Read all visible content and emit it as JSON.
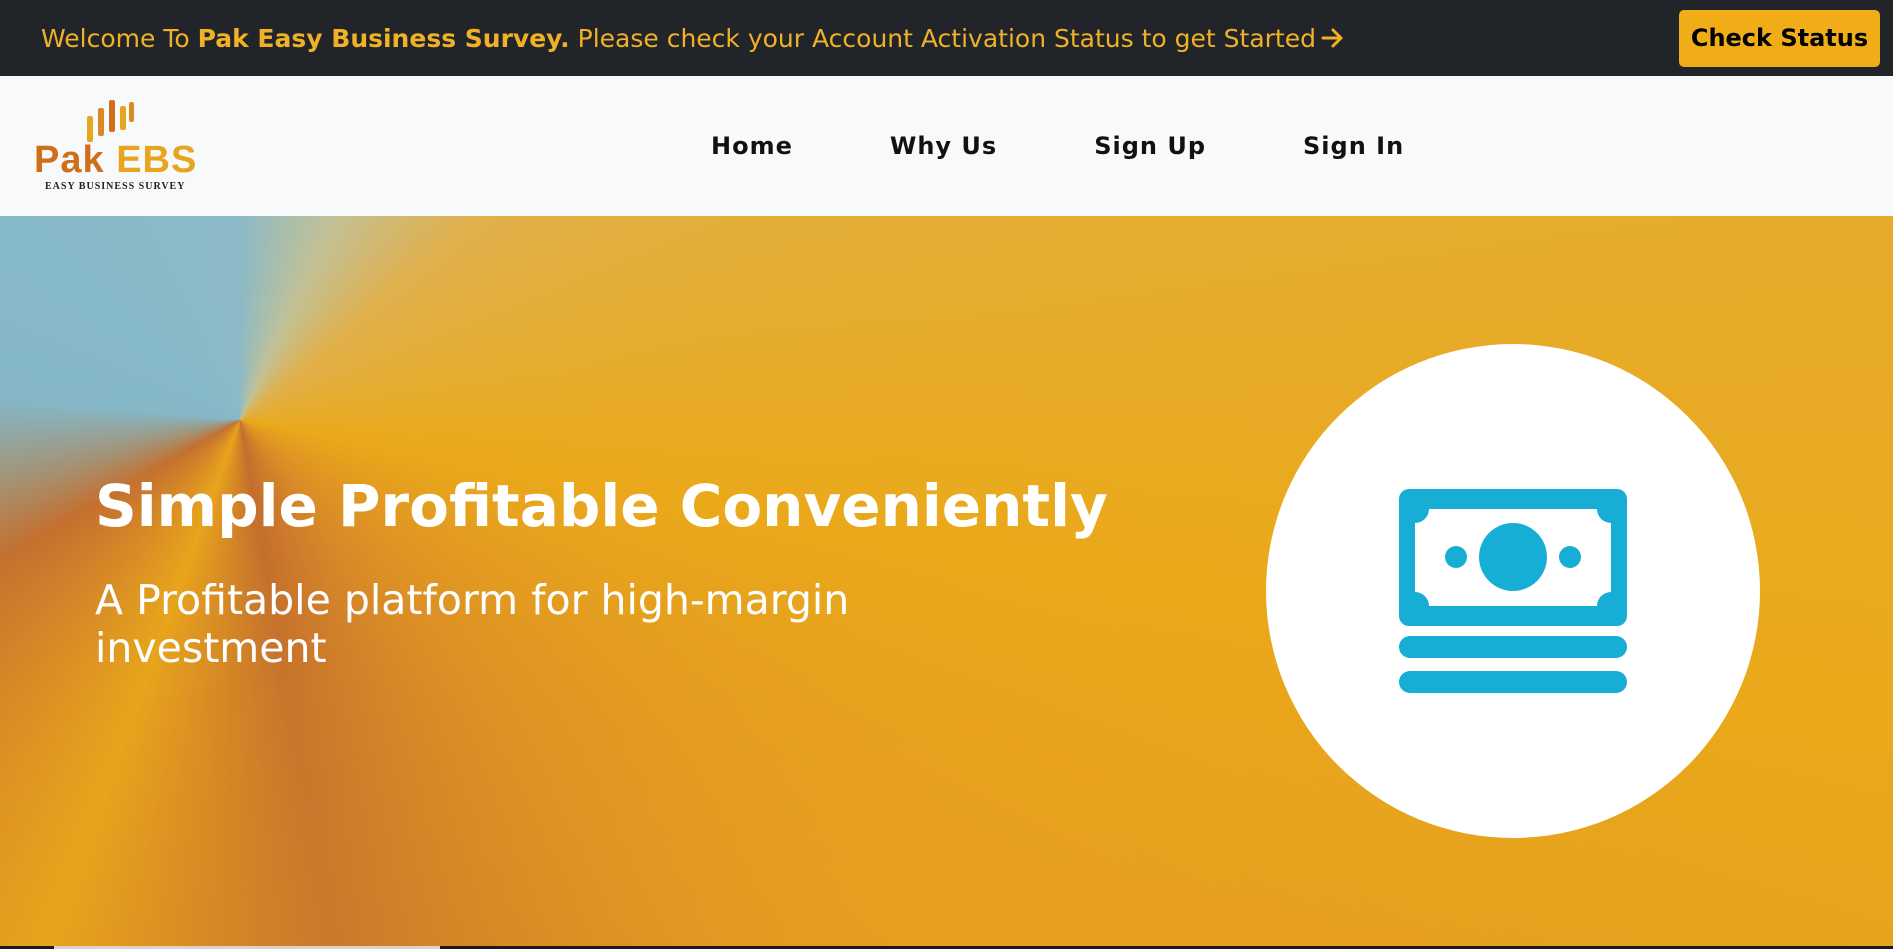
{
  "topbar": {
    "message_prefix": "Welcome To ",
    "brand": "Pak Easy Business Survey.",
    "message_suffix": "Please check your Account Activation Status to get Started",
    "arrow_icon": "arrow-right-icon",
    "check_status_label": "Check Status"
  },
  "navbar": {
    "logo": {
      "name_part1": "Pak",
      "name_part2": "EBS",
      "tagline": "EASY BUSINESS SURVEY"
    },
    "links": [
      {
        "label": "Home"
      },
      {
        "label": "Why Us"
      },
      {
        "label": "Sign Up"
      },
      {
        "label": "Sign In"
      }
    ]
  },
  "hero": {
    "title": "Simple Profitable Conveniently",
    "subtitle": "A Profitable platform for high-margin investment",
    "icon": "money-bill-icon"
  },
  "colors": {
    "topbar_bg": "#212529",
    "accent": "#f0ad18",
    "icon_blue": "#17aed5",
    "navbar_bg": "#f8f9fa"
  }
}
